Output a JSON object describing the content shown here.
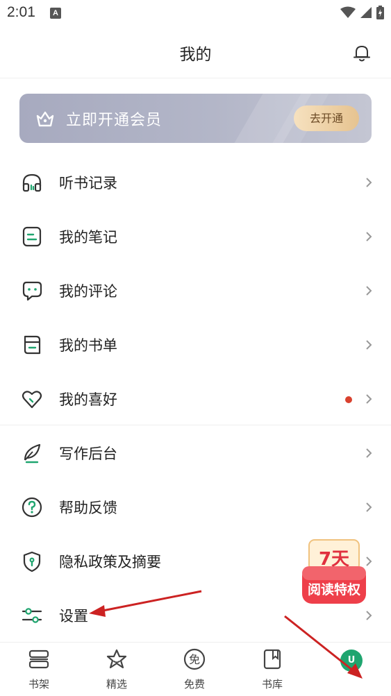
{
  "status_bar": {
    "time": "2:01",
    "notification_glyph": "A"
  },
  "header": {
    "title": "我的"
  },
  "vip": {
    "text": "立即开通会员",
    "button": "去开通"
  },
  "menu": [
    {
      "label": "听书记录",
      "icon": "headphones-icon"
    },
    {
      "label": "我的笔记",
      "icon": "note-icon"
    },
    {
      "label": "我的评论",
      "icon": "comment-icon"
    },
    {
      "label": "我的书单",
      "icon": "booklist-icon"
    },
    {
      "label": "我的喜好",
      "icon": "heart-icon",
      "badge": "red-dot"
    },
    {
      "label": "写作后台",
      "icon": "feather-icon"
    },
    {
      "label": "帮助反馈",
      "icon": "help-icon"
    },
    {
      "label": "隐私政策及摘要",
      "icon": "shield-icon"
    },
    {
      "label": "设置",
      "icon": "settings-sliders-icon"
    }
  ],
  "promo": {
    "line1": "7天",
    "line2": "阅读特权"
  },
  "tabs": [
    {
      "label": "书架",
      "icon": "bookshelf-icon"
    },
    {
      "label": "精选",
      "icon": "star-icon"
    },
    {
      "label": "免费",
      "icon": "free-icon",
      "icon_text": "免"
    },
    {
      "label": "书库",
      "icon": "library-icon"
    },
    {
      "label": "",
      "icon": "avatar"
    }
  ],
  "avatar": {
    "initial": "U"
  },
  "colors": {
    "accent": "#1fa56f",
    "red_dot": "#d9412e",
    "vip_bg": "#b0b3c6",
    "vip_button": "#f0d6ad",
    "annotation_arrow": "#cc2222"
  }
}
